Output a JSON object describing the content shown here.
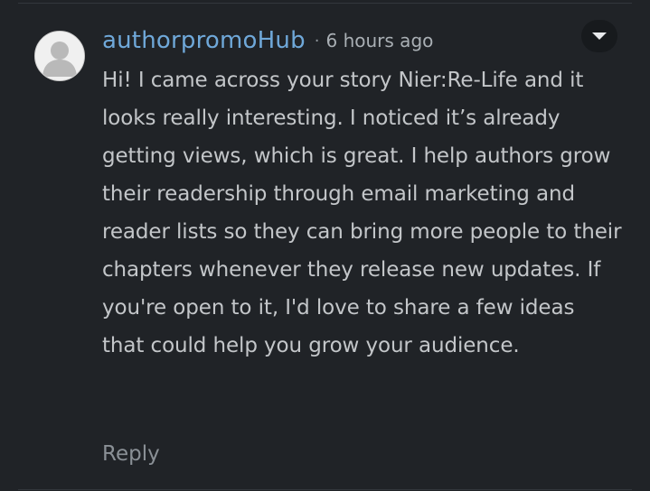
{
  "comment": {
    "author": "authorpromoHub",
    "separator": "·",
    "timestamp": "6 hours ago",
    "body": "Hi! I came across your story Nier:Re-Life and it looks really interesting. I noticed it’s already getting views, which is great. I help authors grow their readership through email marketing and reader lists so they can bring more people to their chapters whenever they release new updates. If you're open to it, I'd love to share a few ideas that could help you grow your audience.",
    "reply_label": "Reply",
    "menu_icon": "chevron-down-icon",
    "avatar_icon": "default-user-avatar-icon"
  },
  "colors": {
    "background": "#202327",
    "author": "#6fa8d9",
    "body_text": "#c3c6c9",
    "muted_text": "#8a9096",
    "menu_button_bg": "#171a1d"
  }
}
